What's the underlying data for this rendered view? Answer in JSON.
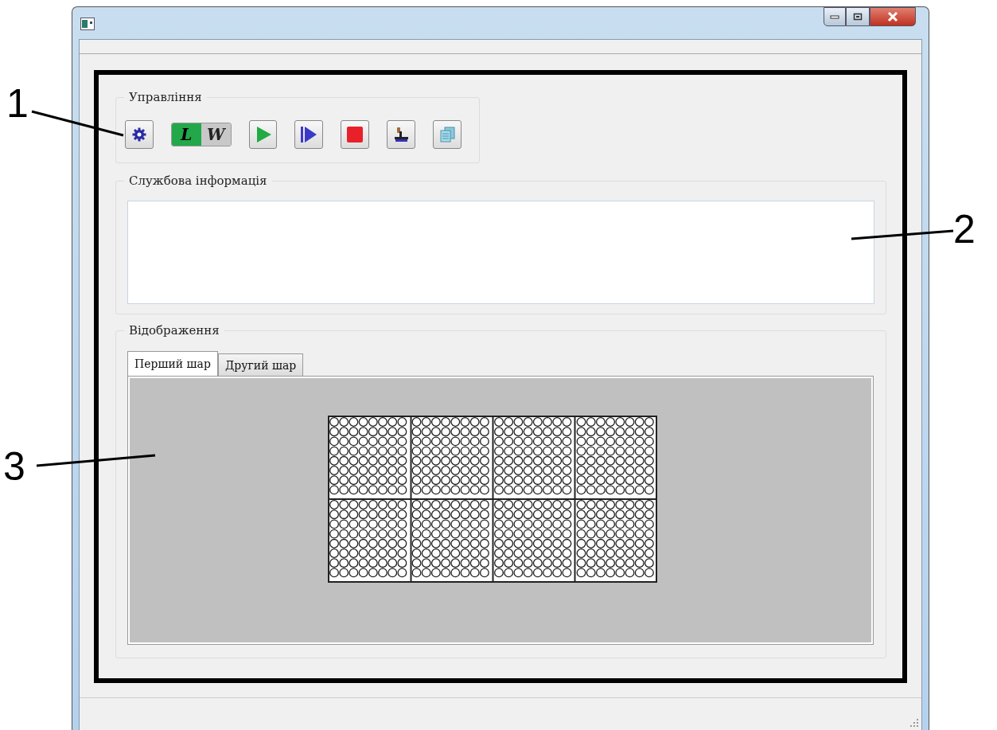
{
  "annotations": [
    {
      "label": "1"
    },
    {
      "label": "2"
    },
    {
      "label": "3"
    }
  ],
  "control_group": {
    "title": "Управління",
    "mode_toggle": [
      {
        "label": "L",
        "selected": true
      },
      {
        "label": "W",
        "selected": false
      }
    ]
  },
  "info_group": {
    "title": "Службова інформація"
  },
  "display_group": {
    "title": "Відображення",
    "tabs": [
      {
        "label": "Перший шар",
        "selected": true
      },
      {
        "label": "Другий шар",
        "selected": false
      }
    ]
  }
}
